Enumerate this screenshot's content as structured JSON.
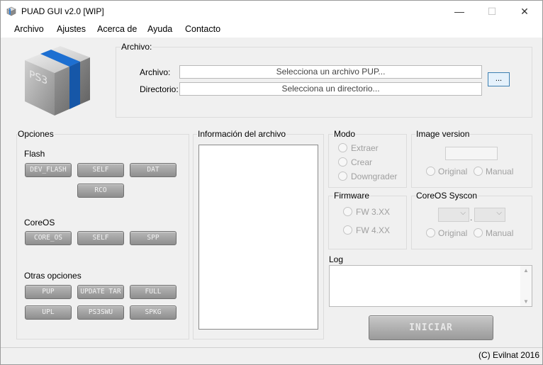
{
  "window": {
    "title": "PUAD GUI v2.0 [WIP]",
    "minimize": "—",
    "maximize": "☐",
    "close": "✕"
  },
  "menu": [
    "Archivo",
    "Ajustes",
    "Acerca de",
    "Ayuda",
    "Contacto"
  ],
  "file_group": {
    "legend": "Archivo:",
    "file_label": "Archivo:",
    "file_value": "Selecciona un archivo PUP...",
    "dir_label": "Directorio:",
    "dir_value": "Selecciona un directorio...",
    "browse": "..."
  },
  "options": {
    "legend": "Opciones",
    "flash_title": "Flash",
    "flash_buttons": [
      "DEV_FLASH",
      "SELF",
      "DAT",
      "RCO"
    ],
    "coreos_title": "CoreOS",
    "coreos_buttons": [
      "CORE_OS",
      "SELF",
      "SPP"
    ],
    "other_title": "Otras opciones",
    "other_buttons": [
      "PUP",
      "UPDATE TAR",
      "FULL",
      "UPL",
      "PS3SWU",
      "SPKG"
    ]
  },
  "info": {
    "legend": "Información del archivo"
  },
  "mode": {
    "legend": "Modo",
    "options": [
      "Extraer",
      "Crear",
      "Downgrader"
    ]
  },
  "image_version": {
    "legend": "Image version",
    "options": [
      "Original",
      "Manual"
    ]
  },
  "firmware": {
    "legend": "Firmware",
    "options": [
      "FW 3.XX",
      "FW 4.XX"
    ]
  },
  "syscon": {
    "legend": "CoreOS Syscon",
    "separator": ".",
    "options": [
      "Original",
      "Manual"
    ]
  },
  "log": {
    "label": "Log"
  },
  "start_button": "INICIAR",
  "status": {
    "copyright": "(C) Evilnat 2016"
  }
}
